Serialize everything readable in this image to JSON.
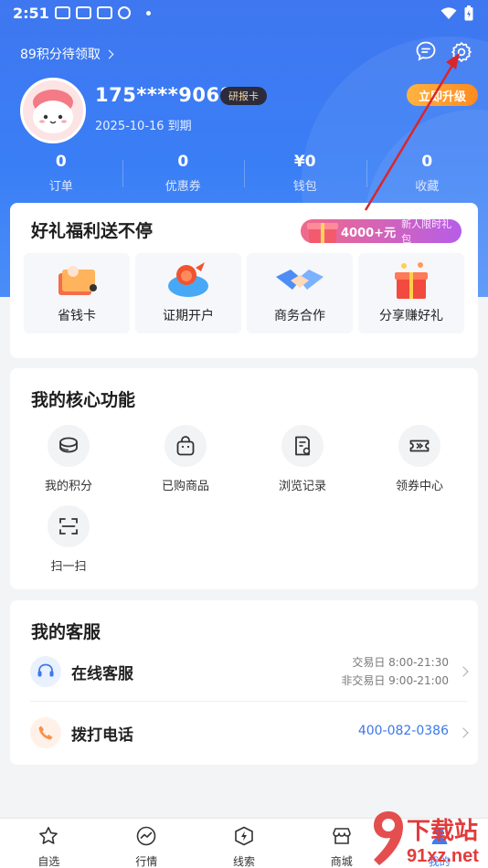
{
  "status_bar": {
    "time": "2:51"
  },
  "header": {
    "points_link": "89积分待领取",
    "username": "175****9068",
    "member_badge": "研报卡",
    "expire_text": "2025-10-16 到期",
    "upgrade_button": "立即升级"
  },
  "stats": [
    {
      "value": "0",
      "label": "订单"
    },
    {
      "value": "0",
      "label": "优惠券"
    },
    {
      "value": "¥0",
      "label": "钱包"
    },
    {
      "value": "0",
      "label": "收藏"
    }
  ],
  "benefits": {
    "title": "好礼福利送不停",
    "promo_amount": "4000+元",
    "promo_text": "新人限时礼包",
    "items": [
      {
        "label": "省钱卡",
        "icon": "coupon-card-icon"
      },
      {
        "label": "证期开户",
        "icon": "lion-mascot-icon"
      },
      {
        "label": "商务合作",
        "icon": "handshake-icon"
      },
      {
        "label": "分享赚好礼",
        "icon": "gift-box-icon"
      }
    ]
  },
  "core": {
    "title": "我的核心功能",
    "items": [
      {
        "label": "我的积分",
        "icon": "coins-icon"
      },
      {
        "label": "已购商品",
        "icon": "shopping-bag-icon"
      },
      {
        "label": "浏览记录",
        "icon": "history-doc-icon"
      },
      {
        "label": "领券中心",
        "icon": "ticket-icon"
      },
      {
        "label": "扫一扫",
        "icon": "scan-icon"
      }
    ]
  },
  "service": {
    "title": "我的客服",
    "online": {
      "label": "在线客服",
      "hours_1": "交易日 8:00-21:30",
      "hours_2": "非交易日 9:00-21:00"
    },
    "phone": {
      "label": "拨打电话",
      "number": "400-082-0386"
    }
  },
  "tabbar": [
    {
      "label": "自选",
      "icon": "star-icon"
    },
    {
      "label": "行情",
      "icon": "chart-line-icon"
    },
    {
      "label": "线索",
      "icon": "lightning-icon"
    },
    {
      "label": "商城",
      "icon": "shop-icon"
    },
    {
      "label": "我的",
      "icon": "user-icon"
    }
  ],
  "watermark": {
    "brand": "下载站",
    "site": "91xz.net"
  },
  "colors": {
    "primary_blue": "#3a7ef6",
    "upgrade_orange": "#ff8a1f",
    "promo_pink": "#f06a8a",
    "arrow_red": "#d9262c"
  }
}
